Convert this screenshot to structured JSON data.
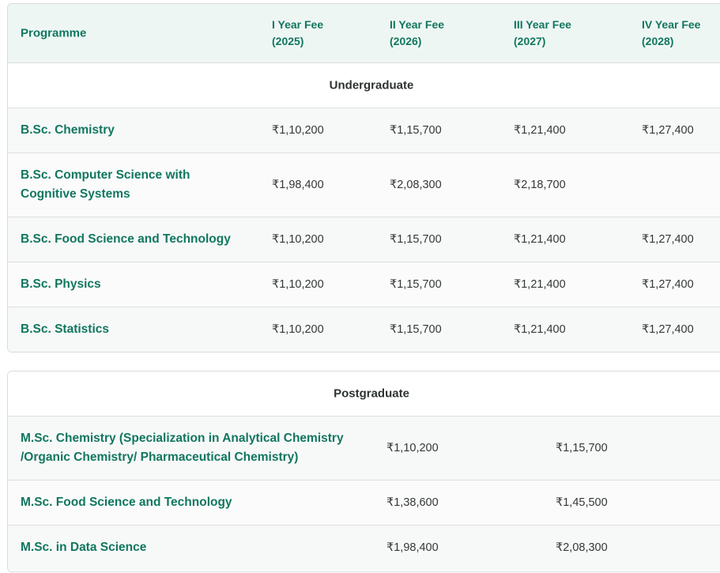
{
  "undergraduate_table": {
    "headers": {
      "programme": "Programme",
      "year1": [
        "I Year Fee",
        "(2025)"
      ],
      "year2": [
        "II Year Fee",
        "(2026)"
      ],
      "year3": [
        "III Year Fee",
        "(2027)"
      ],
      "year4": [
        "IV Year Fee",
        "(2028)"
      ]
    },
    "section_label": "Undergraduate",
    "rows": [
      {
        "name": "B.Sc. Chemistry",
        "fees": [
          "₹1,10,200",
          "₹1,15,700",
          "₹1,21,400",
          "₹1,27,400"
        ]
      },
      {
        "name": "B.Sc. Computer Science with Cognitive Systems",
        "fees": [
          "₹1,98,400",
          "₹2,08,300",
          "₹2,18,700",
          ""
        ]
      },
      {
        "name": "B.Sc. Food Science and Technology",
        "fees": [
          "₹1,10,200",
          "₹1,15,700",
          "₹1,21,400",
          "₹1,27,400"
        ]
      },
      {
        "name": "B.Sc. Physics",
        "fees": [
          "₹1,10,200",
          "₹1,15,700",
          "₹1,21,400",
          "₹1,27,400"
        ]
      },
      {
        "name": "B.Sc. Statistics",
        "fees": [
          "₹1,10,200",
          "₹1,15,700",
          "₹1,21,400",
          "₹1,27,400"
        ]
      }
    ]
  },
  "postgraduate_table": {
    "section_label": "Postgraduate",
    "rows": [
      {
        "name": "M.Sc. Chemistry (Specialization in Analytical Chemistry /Organic Chemistry/ Pharmaceutical Chemistry)",
        "fees": [
          "₹1,10,200",
          "₹1,15,700"
        ]
      },
      {
        "name": "M.Sc. Food Science and Technology",
        "fees": [
          "₹1,38,600",
          "₹1,45,500"
        ]
      },
      {
        "name": "M.Sc. in Data Science",
        "fees": [
          "₹1,98,400",
          "₹2,08,300"
        ]
      }
    ]
  }
}
